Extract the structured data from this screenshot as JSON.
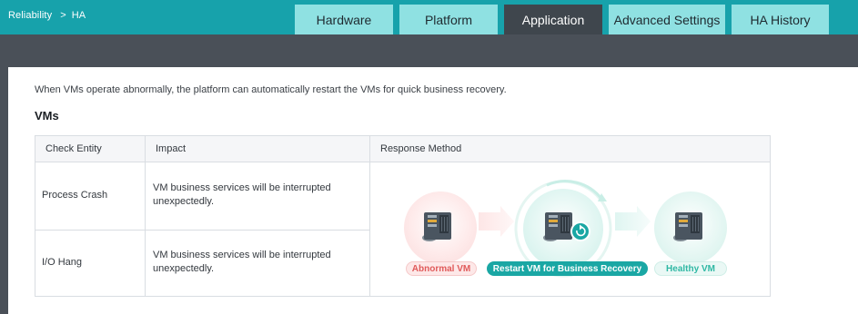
{
  "breadcrumb": {
    "parent": "Reliability",
    "separator": ">",
    "current": "HA"
  },
  "tabs": [
    {
      "label": "Hardware",
      "active": false
    },
    {
      "label": "Platform",
      "active": false
    },
    {
      "label": "Application",
      "active": true
    },
    {
      "label": "Advanced Settings",
      "active": false
    },
    {
      "label": "HA History",
      "active": false
    }
  ],
  "main": {
    "description": "When VMs operate abnormally, the platform can automatically restart the VMs for quick business recovery.",
    "section_title": "VMs",
    "table": {
      "headers": [
        "Check Entity",
        "Impact",
        "Response Method"
      ],
      "rows": [
        {
          "entity": "Process Crash",
          "impact": "VM business services will be interrupted unexpectedly."
        },
        {
          "entity": "I/O Hang",
          "impact": "VM business services will be interrupted unexpectedly."
        }
      ]
    },
    "diagram": {
      "abnormal_label": "Abnormal VM",
      "restart_label": "Restart VM for Business Recovery",
      "healthy_label": "Healthy VM"
    }
  },
  "colors": {
    "topbar": "#17a2ab",
    "tab_inactive": "#8fe1e2",
    "tab_active": "#3f464d",
    "backdrop": "#4a5058",
    "abnormal": "#e05a5a",
    "restart": "#1aa7a4",
    "healthy": "#2fb8a4"
  }
}
